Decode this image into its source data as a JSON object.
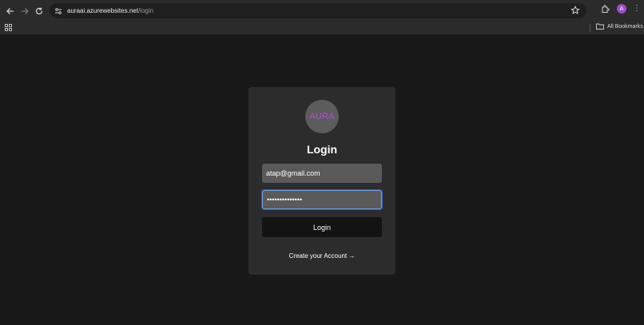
{
  "browser": {
    "url_host": "auraai.azurewebsites.net",
    "url_path": "/login",
    "profile_initial": "A",
    "bookmarks_label": "All Bookmarks"
  },
  "login": {
    "logo_text": "AURA",
    "title": "Login",
    "email_value": "atap@gmail.com",
    "password_value": "••••••••••••••",
    "submit_label": "Login",
    "create_account_label": "Create your Account →"
  },
  "colors": {
    "background": "#181818",
    "card": "#2c2c2c",
    "logo_accent": "#b24fd8",
    "focus_ring": "#7a9ce0"
  },
  "icons": [
    "back-icon",
    "forward-icon",
    "reload-icon",
    "site-info-icon",
    "star-icon",
    "extensions-icon",
    "more-icon",
    "apps-icon",
    "folder-icon"
  ]
}
